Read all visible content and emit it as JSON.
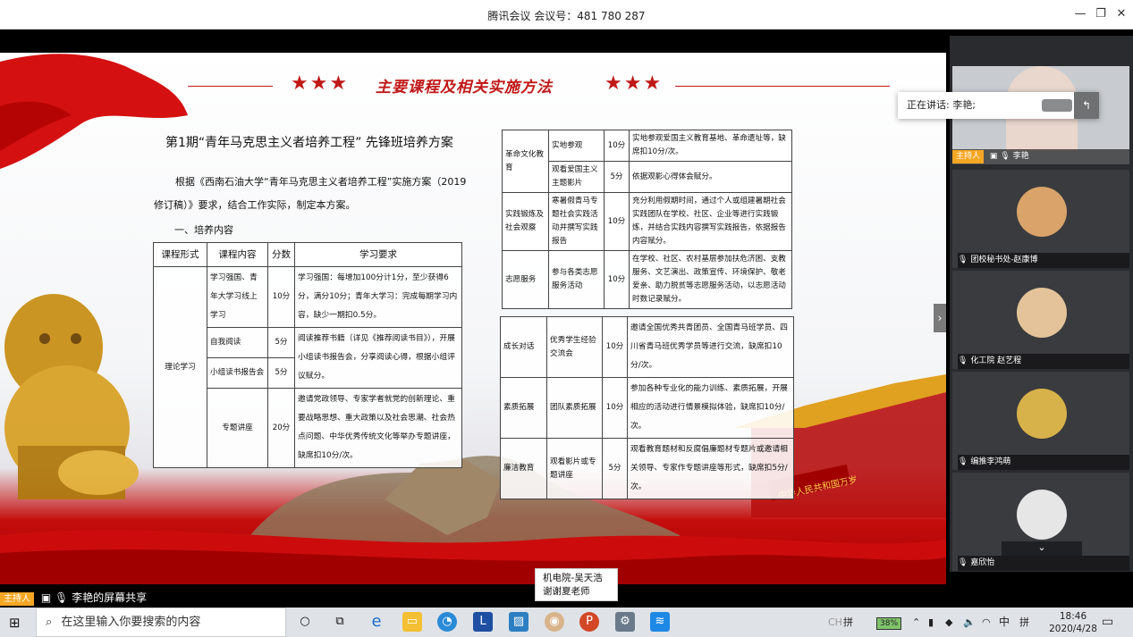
{
  "window": {
    "title": "腾讯会议 会议号：481 780 287"
  },
  "slide": {
    "title": "主要课程及相关实施方法",
    "stars": "★★★",
    "heading": "第1期“青年马克思主义者培养工程” 先锋班培养方案",
    "para": "根据《西南石油大学“青年马克思主义者培养工程”实施方案（2019修订稿）》要求，结合工作实际，制定本方案。",
    "section": "一、培养内容",
    "table_left": {
      "headers": [
        "课程形式",
        "课程内容",
        "分数",
        "学习要求"
      ],
      "group": "理论学习",
      "rows": [
        {
          "content": "学习强国、青年大学习线上学习",
          "score": "10分",
          "req": "学习强国：每增加100分计1分，至少获得6分，满分10分；青年大学习：完成每期学习内容，缺少一期扣0.5分。"
        },
        {
          "content": "自我阅读",
          "score": "5分",
          "req": "阅读推荐书籍（详见《推荐阅读书目》），开展小组读书报告会，分享阅读心得，根据小组评议赋分。"
        },
        {
          "content": "小组读书报告会",
          "score": "5分",
          "req": ""
        },
        {
          "content": "专题讲座",
          "score": "20分",
          "req": "邀请党政领导、专家学者就党的创新理论、重要战略思想、重大政策以及社会思潮、社会热点问题、中华优秀传统文化等举办专题讲座，缺席扣10分/次。"
        }
      ]
    },
    "table_right1": [
      {
        "type": "革命文化教育",
        "items": [
          {
            "content": "实地参观",
            "score": "10分",
            "req": "实地参观爱国主义教育基地、革命遗址等，缺席扣10分/次。"
          },
          {
            "content": "观看爱国主义主题影片",
            "score": "5分",
            "req": "依据观影心得体会赋分。"
          }
        ]
      },
      {
        "type": "实践锻炼及社会观察",
        "items": [
          {
            "content": "寒暑假青马专题社会实践活动并撰写实践报告",
            "score": "10分",
            "req": "充分利用假期时间，通过个人或组建暑期社会实践团队在学校、社区、企业等进行实践锻炼，并结合实践内容撰写实践报告，依据报告内容赋分。"
          }
        ]
      },
      {
        "type": "志愿服务",
        "items": [
          {
            "content": "参与各类志愿服务活动",
            "score": "10分",
            "req": "在学校、社区、农村基层参加扶危济困、支教服务、文艺演出、政策宣传、环境保护、敬老爱亲、助力脱贫等志愿服务活动，以志愿活动时数记录赋分。"
          }
        ]
      }
    ],
    "table_right2": [
      {
        "type": "成长对话",
        "content": "优秀学生经验交流会",
        "score": "10分",
        "req": "邀请全国优秀共青团员、全国青马班学员、四川省青马班优秀学员等进行交流，缺席扣10分/次。"
      },
      {
        "type": "素质拓展",
        "content": "团队素质拓展",
        "score": "10分",
        "req": "参加各种专业化的能力训练、素质拓展，开展相应的活动进行情景模拟体验，缺席扣10分/次。"
      },
      {
        "type": "廉洁教育",
        "content": "观看影片或专题讲座",
        "score": "5分",
        "req": "观看教育题材和反腐倡廉题材专题片或邀请相关领导、专家作专题讲座等形式，缺席扣5分/次。"
      }
    ],
    "banner_text": "中华人民共和国万岁"
  },
  "panel": {
    "speaking": "正在讲话: 李艳;",
    "host_label": "主持人",
    "participants": [
      {
        "name": "李艳",
        "host": true
      },
      {
        "name": "团校秘书处-赵康博",
        "host": false
      },
      {
        "name": "化工院 赵艺程",
        "host": false
      },
      {
        "name": "编推李鸿萌",
        "host": false
      },
      {
        "name": "嘉欣怡",
        "host": false
      }
    ]
  },
  "share": {
    "host_label": "主持人",
    "text": "李艳的屏幕共享"
  },
  "chat_popup": {
    "line1": "机电院-吴天浩",
    "line2": "谢谢夏老师"
  },
  "taskbar": {
    "search_placeholder": "在这里输入你要搜索的内容",
    "battery": "38%",
    "ime": "中",
    "time": "18:46",
    "date": "2020/4/28",
    "tray_cn": "CH",
    "tray_grid": "拼"
  },
  "colors": {
    "accent": "#c01818",
    "host": "#f5a623"
  }
}
